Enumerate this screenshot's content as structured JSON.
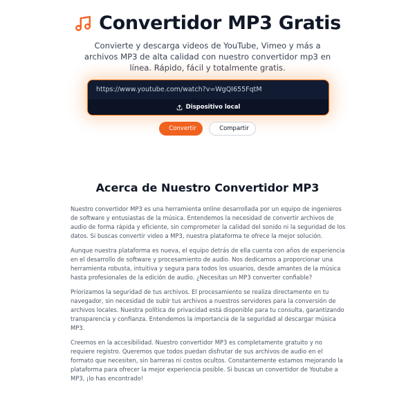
{
  "hero": {
    "title": "Convertidor MP3 Gratis",
    "subtitle": "Convierte y descarga videos de YouTube, Vimeo y más a archivos MP3 de alta calidad con nuestro convertidor mp3 en línea. Rápido, fácil y totalmente gratis."
  },
  "converter": {
    "url_value": "https://www.youtube.com/watch?v=WgQI655FqtM",
    "local_device_label": "Dispositivo local"
  },
  "actions": {
    "convert_label": "Convertir",
    "share_label": "Compartir"
  },
  "about": {
    "title": "Acerca de Nuestro Convertidor MP3",
    "paragraphs": [
      "Nuestro convertidor MP3 es una herramienta online desarrollada por un equipo de ingenieros de software y entusiastas de la música. Entendemos la necesidad de convertir archivos de audio de forma rápida y eficiente, sin comprometer la calidad del sonido ni la seguridad de los datos. Si buscas convertir video a MP3, nuestra plataforma te ofrece la mejor solución.",
      "Aunque nuestra plataforma es nueva, el equipo detrás de ella cuenta con años de experiencia en el desarrollo de software y procesamiento de audio. Nos dedicamos a proporcionar una herramienta robusta, intuitiva y segura para todos los usuarios, desde amantes de la música hasta profesionales de la edición de audio. ¿Necesitas un MP3 converter confiable?",
      "Priorizamos la seguridad de tus archivos. El procesamiento se realiza directamente en tu navegador, sin necesidad de subir tus archivos a nuestros servidores para la conversión de archivos locales. Nuestra política de privacidad está disponible para tu consulta, garantizando transparencia y confianza. Entendemos la importancia de la seguridad al descargar música MP3.",
      "Creemos en la accesibilidad. Nuestro convertidor MP3 es completamente gratuito y no requiere registro. Queremos que todos puedan disfrutar de sus archivos de audio en el formato que necesiten, sin barreras ni costos ocultos. Constantemente estamos mejorando la plataforma para ofrecer la mejor experiencia posible. Si buscas un convertidor de Youtube a MP3, ¡lo has encontrado!"
    ]
  },
  "icons": {
    "logo": "music-note-icon",
    "upload": "upload-icon",
    "download": "download-icon",
    "link": "link-icon"
  },
  "colors": {
    "accent": "#f0621f",
    "dark_panel": "#0f172a",
    "heading": "#111827",
    "body_text": "#4b5563"
  }
}
